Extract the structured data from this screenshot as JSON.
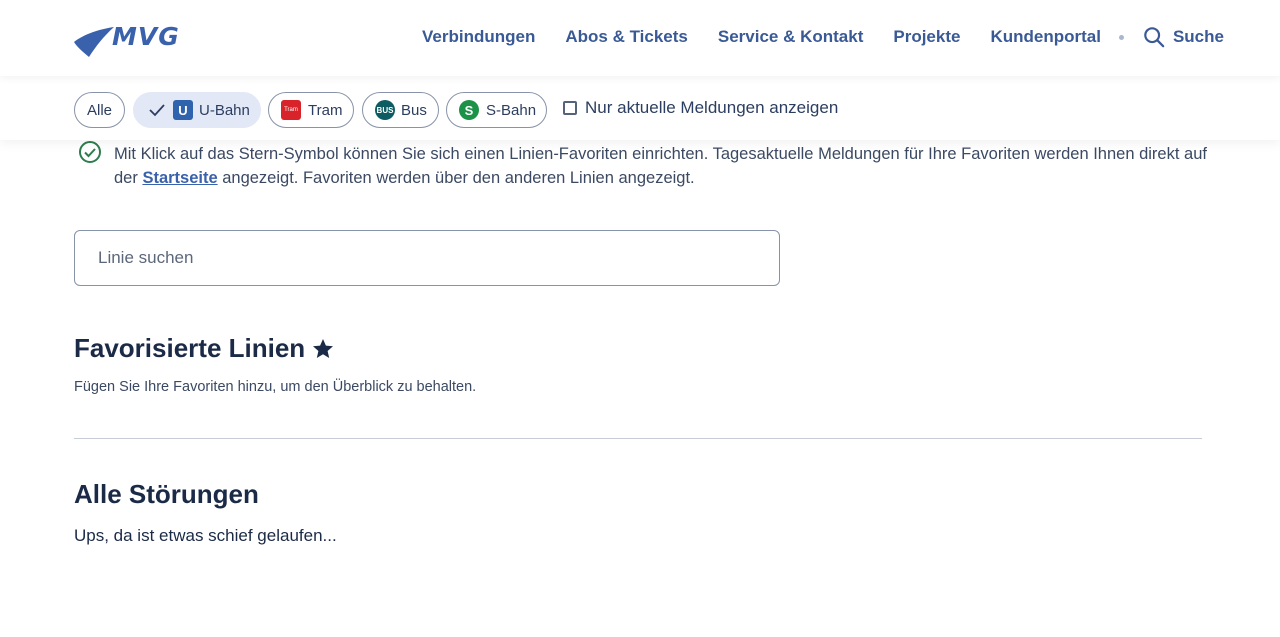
{
  "header": {
    "logo_text": "MVG",
    "nav": [
      "Verbindungen",
      "Abos & Tickets",
      "Service & Kontakt",
      "Projekte",
      "Kundenportal"
    ],
    "search_label": "Suche"
  },
  "filters": {
    "chips": {
      "alle": "Alle",
      "ubahn": "U-Bahn",
      "tram": "Tram",
      "bus": "Bus",
      "sbahn": "S-Bahn"
    },
    "icons": {
      "ubahn": "U",
      "tram": "Tram",
      "bus": "BUS",
      "sbahn": "S"
    },
    "checkbox_label": "Nur aktuelle Meldungen anzeigen"
  },
  "info": {
    "text_before": "Mit Klick auf das Stern-Symbol können Sie sich einen Linien-Favoriten einrichten. Tagesaktuelle Meldungen für Ihre Favoriten werden Ihnen direkt auf der ",
    "link": "Startseite",
    "text_after": " angezeigt. Favoriten werden über den anderen Linien angezeigt."
  },
  "search": {
    "placeholder": "Linie suchen"
  },
  "favorites": {
    "title": "Favorisierte Linien",
    "subtitle": "Fügen Sie Ihre Favoriten hinzu, um den Überblick zu behalten."
  },
  "disruptions": {
    "title": "Alle Störungen",
    "error": "Ups, da ist etwas schief gelaufen..."
  },
  "colors": {
    "brand": "#3a62ac",
    "ubahn": "#3063ad",
    "tram": "#d8232a",
    "bus": "#0d5c63",
    "sbahn": "#1c9148",
    "success": "#2e7d4f"
  }
}
